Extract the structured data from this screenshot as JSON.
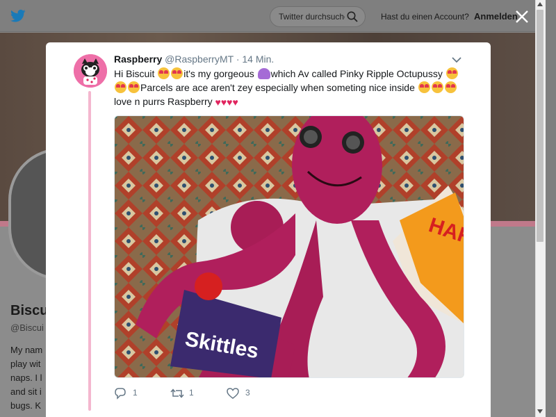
{
  "topbar": {
    "search_placeholder": "Twitter durchsuchen",
    "account_question": "Hast du einen Account?",
    "login_label": "Anmelden"
  },
  "profile": {
    "name": "Biscu",
    "handle": "@Biscui",
    "bio_lines": [
      "My nam",
      "play wit",
      "naps. I l",
      "and sit i",
      "bugs. K"
    ]
  },
  "tweet": {
    "display_name": "Raspberry",
    "handle": "@RaspberryMT",
    "separator": "·",
    "time": "14 Min.",
    "text_1": "Hi Biscuit ",
    "text_2": "it's my gorgeous ",
    "text_3": "which Av called Pinky Ripple Octupussy ",
    "text_4": "Parcels are ace aren't zey especially when someting nice inside ",
    "text_5": "love n purrs Raspberry ",
    "reply_count": "1",
    "retweet_count": "1",
    "like_count": "3"
  },
  "icons": [
    "twitter-bird-icon",
    "search-icon",
    "close-icon",
    "chevron-down-icon",
    "reply-icon",
    "retweet-icon",
    "like-icon"
  ],
  "colors": {
    "twitter_blue": "#1da1f2",
    "text_primary": "#14171a",
    "text_secondary": "#657786",
    "thread_line": "#f4b7cf",
    "avatar_bg": "#ee6fa8"
  }
}
